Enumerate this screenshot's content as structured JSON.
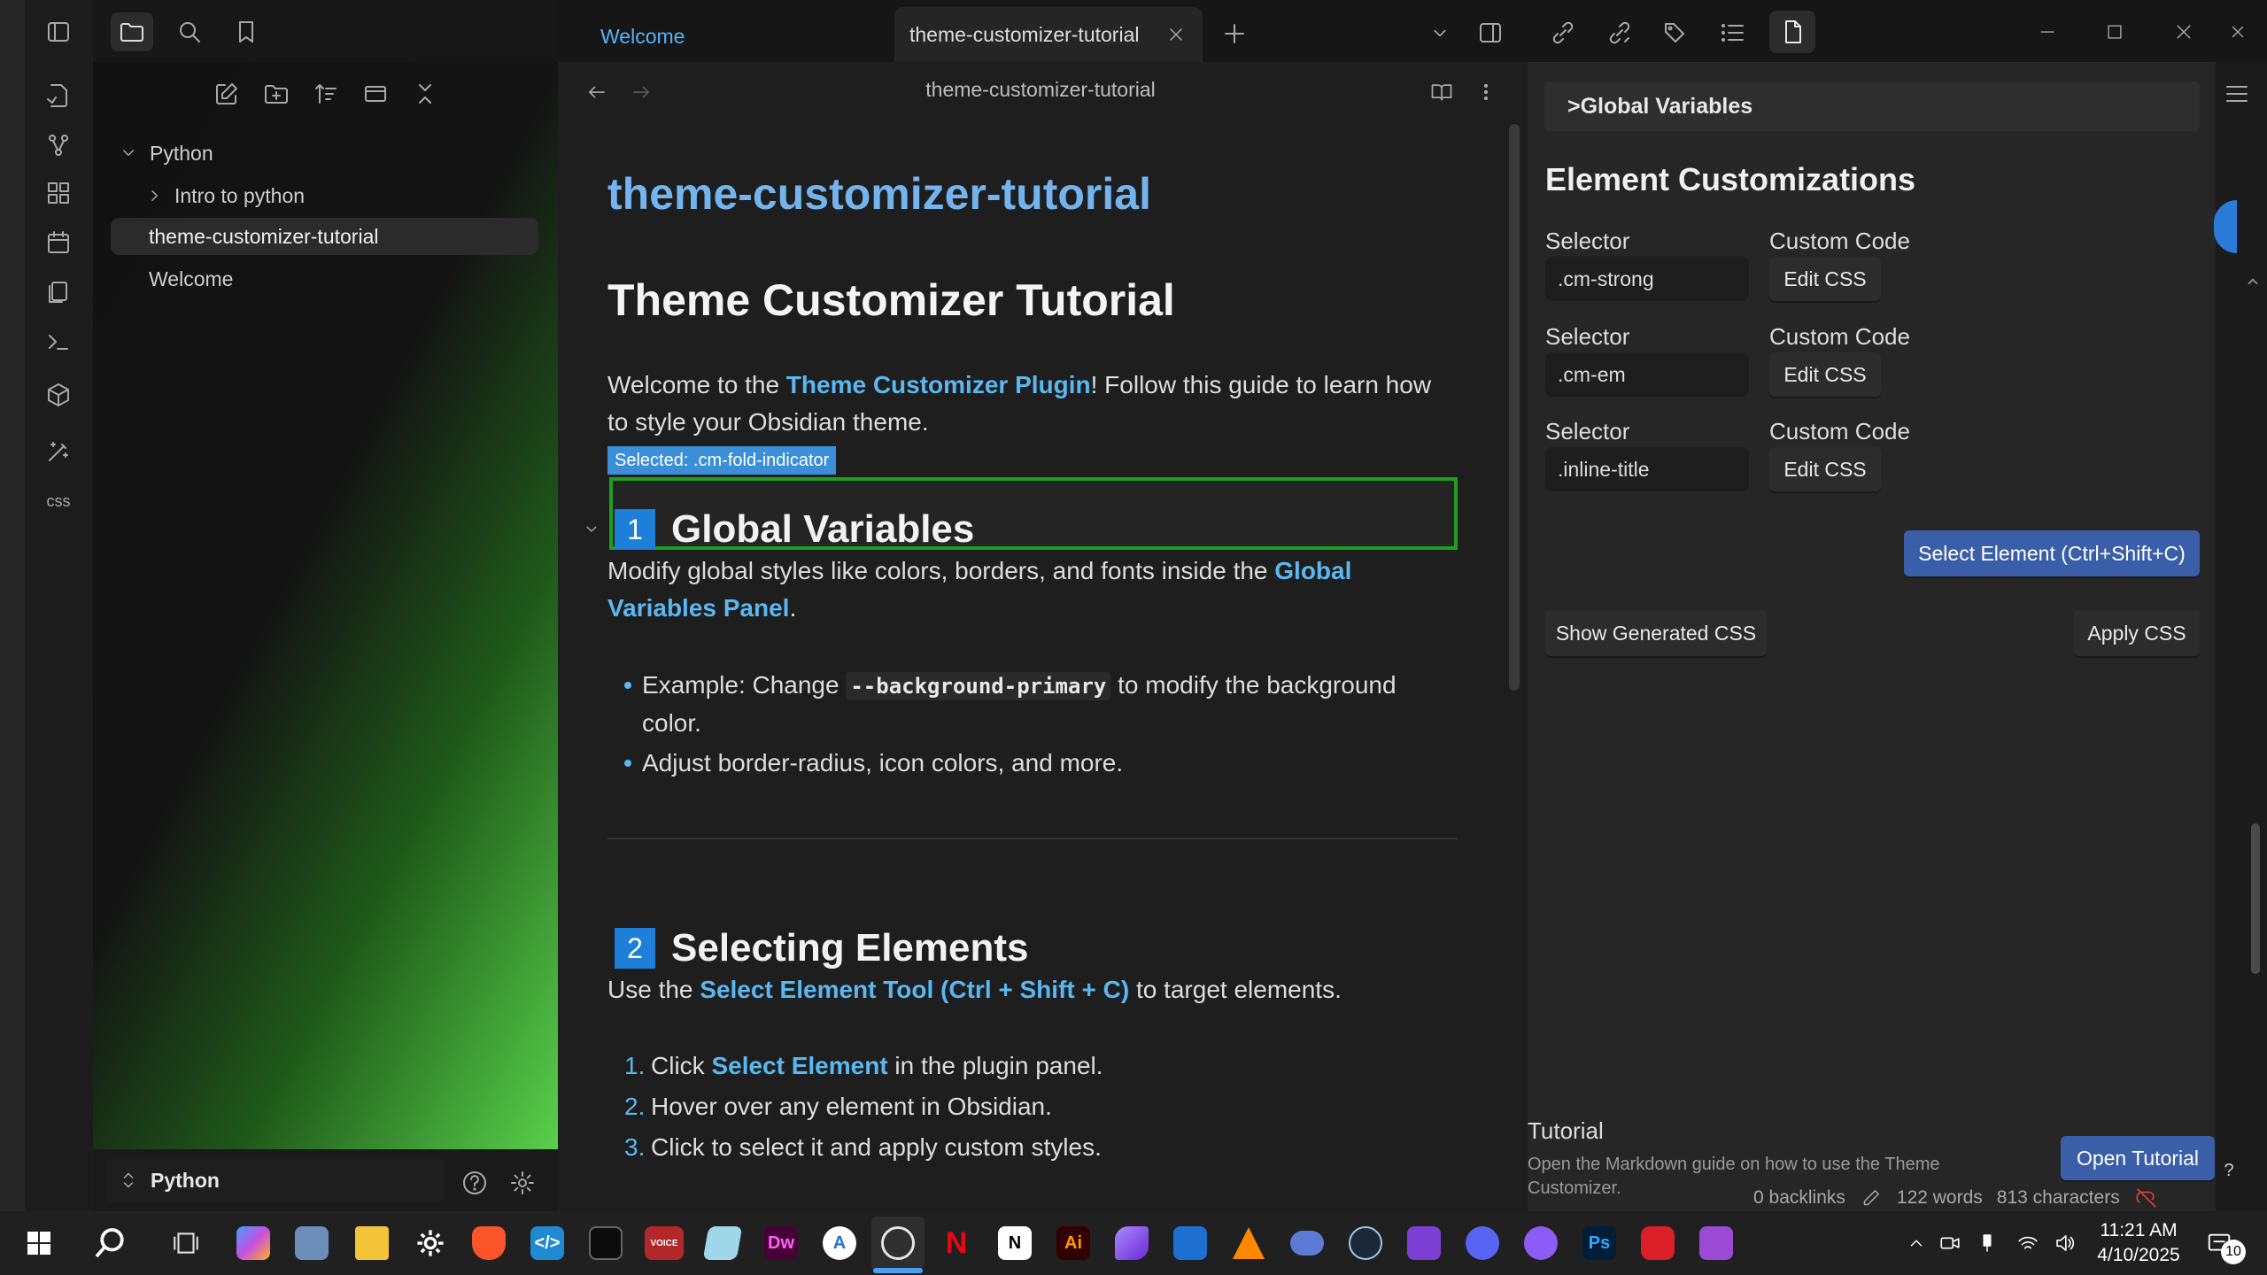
{
  "tabs": {
    "welcome": "Welcome",
    "active": "theme-customizer-tutorial"
  },
  "explorer": {
    "vault_name": "Python",
    "items": [
      {
        "label": "Python"
      },
      {
        "label": "Intro to python"
      },
      {
        "label": "theme-customizer-tutorial"
      },
      {
        "label": "Welcome"
      }
    ]
  },
  "editor": {
    "header_title": "theme-customizer-tutorial",
    "inline_title": "theme-customizer-tutorial",
    "h1": "Theme Customizer Tutorial",
    "intro_pre": "Welcome to the ",
    "intro_link": "Theme Customizer Plugin",
    "intro_post": "! Follow this guide to learn how to style your Obsidian theme.",
    "selected_badge": "Selected: .cm-fold-indicator",
    "s1_num": "1",
    "s1_title": "Global Variables",
    "s1_pre": "Modify global styles like colors, borders, and fonts inside the ",
    "s1_link": "Global Variables Panel",
    "s1_post": ".",
    "b1_pre": "Example: Change ",
    "b1_code": "--background-primary",
    "b1_post": " to modify the background color.",
    "b2": "Adjust border-radius, icon colors, and more.",
    "s2_num": "2",
    "s2_title": "Selecting Elements",
    "s2_pre": "Use the ",
    "s2_link": "Select Element Tool (Ctrl + Shift + C)",
    "s2_post": " to target elements.",
    "ol1_n": "1.",
    "ol1_pre": "Click ",
    "ol1_link": "Select Element",
    "ol1_post": " in the plugin panel.",
    "ol2_n": "2.",
    "ol2": "Hover over any element in Obsidian.",
    "ol3_n": "3.",
    "ol3": "Click to select it and apply custom styles."
  },
  "panel": {
    "collapse_header": ">Global Variables",
    "title": "Element Customizations",
    "rows": [
      {
        "selector_label": "Selector",
        "code_label": "Custom Code",
        "value": ".cm-strong",
        "button": "Edit CSS"
      },
      {
        "selector_label": "Selector",
        "code_label": "Custom Code",
        "value": ".cm-em",
        "button": "Edit CSS"
      },
      {
        "selector_label": "Selector",
        "code_label": "Custom Code",
        "value": ".inline-title",
        "button": "Edit CSS"
      }
    ],
    "select_button": "Select Element (Ctrl+Shift+C)",
    "show_css": "Show Generated CSS",
    "apply_css": "Apply CSS",
    "tutorial_title": "Tutorial",
    "tutorial_desc": "Open the Markdown guide on how to use the Theme Customizer.",
    "open_tutorial": "Open Tutorial"
  },
  "statusbar": {
    "backlinks": "0 backlinks",
    "words": "122 words",
    "chars": "813 characters"
  },
  "clock": {
    "time": "11:21 AM",
    "date": "4/10/2025",
    "notif": "10"
  },
  "colors": {
    "accent": "#5ab7f0",
    "selected_outline": "#1f9e1f",
    "badge": "#3a8fd8",
    "primary_button": "#3a5fa8"
  }
}
